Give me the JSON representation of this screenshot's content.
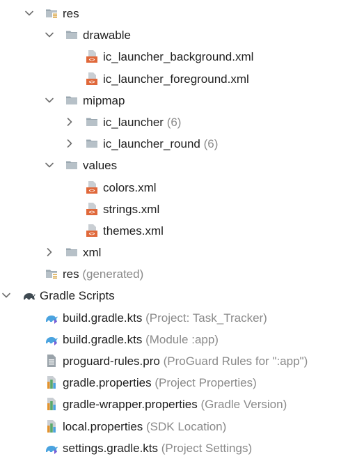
{
  "tree": {
    "rows": [
      {
        "name": "res",
        "hint": "",
        "depth": 0,
        "chevron": "down",
        "icon": "res-folder-icon"
      },
      {
        "name": "drawable",
        "hint": "",
        "depth": 1,
        "chevron": "down",
        "icon": "folder-icon"
      },
      {
        "name": "ic_launcher_background.xml",
        "hint": "",
        "depth": 2,
        "chevron": "none",
        "icon": "xml-file-icon"
      },
      {
        "name": "ic_launcher_foreground.xml",
        "hint": "",
        "depth": 2,
        "chevron": "none",
        "icon": "xml-file-icon"
      },
      {
        "name": "mipmap",
        "hint": "",
        "depth": 1,
        "chevron": "down",
        "icon": "folder-icon"
      },
      {
        "name": "ic_launcher",
        "hint": "(6)",
        "depth": 2,
        "chevron": "right",
        "icon": "folder-icon"
      },
      {
        "name": "ic_launcher_round",
        "hint": "(6)",
        "depth": 2,
        "chevron": "right",
        "icon": "folder-icon"
      },
      {
        "name": "values",
        "hint": "",
        "depth": 1,
        "chevron": "down",
        "icon": "folder-icon"
      },
      {
        "name": "colors.xml",
        "hint": "",
        "depth": 2,
        "chevron": "none",
        "icon": "xml-file-icon"
      },
      {
        "name": "strings.xml",
        "hint": "",
        "depth": 2,
        "chevron": "none",
        "icon": "xml-file-icon"
      },
      {
        "name": "themes.xml",
        "hint": "",
        "depth": 2,
        "chevron": "none",
        "icon": "xml-file-icon"
      },
      {
        "name": "xml",
        "hint": "",
        "depth": 1,
        "chevron": "right",
        "icon": "folder-icon"
      },
      {
        "name": "res",
        "hint": "(generated)",
        "depth": 0,
        "chevron": "none",
        "icon": "res-folder-icon"
      },
      {
        "name": "Gradle Scripts",
        "hint": "",
        "depth": -1,
        "chevron": "down",
        "icon": "gradle-elephant-icon"
      },
      {
        "name": "build.gradle.kts",
        "hint": "(Project: Task_Tracker)",
        "depth": 0,
        "chevron": "none",
        "icon": "gradle-kts-icon"
      },
      {
        "name": "build.gradle.kts",
        "hint": "(Module :app)",
        "depth": 0,
        "chevron": "none",
        "icon": "gradle-kts-icon"
      },
      {
        "name": "proguard-rules.pro",
        "hint": "(ProGuard Rules for \":app\")",
        "depth": 0,
        "chevron": "none",
        "icon": "text-file-icon"
      },
      {
        "name": "gradle.properties",
        "hint": "(Project Properties)",
        "depth": 0,
        "chevron": "none",
        "icon": "properties-file-icon"
      },
      {
        "name": "gradle-wrapper.properties",
        "hint": "(Gradle Version)",
        "depth": 0,
        "chevron": "none",
        "icon": "properties-file-icon"
      },
      {
        "name": "local.properties",
        "hint": "(SDK Location)",
        "depth": 0,
        "chevron": "none",
        "icon": "properties-file-icon"
      },
      {
        "name": "settings.gradle.kts",
        "hint": "(Project Settings)",
        "depth": 0,
        "chevron": "none",
        "icon": "gradle-kts-icon"
      }
    ]
  },
  "colors": {
    "folder": "#9aa7b0",
    "xml_orange": "#e0683a",
    "gradle_blue": "#4aa3df",
    "hint_gray": "#8a8a8a",
    "prop_orange": "#e3932d",
    "prop_green": "#59a869"
  }
}
